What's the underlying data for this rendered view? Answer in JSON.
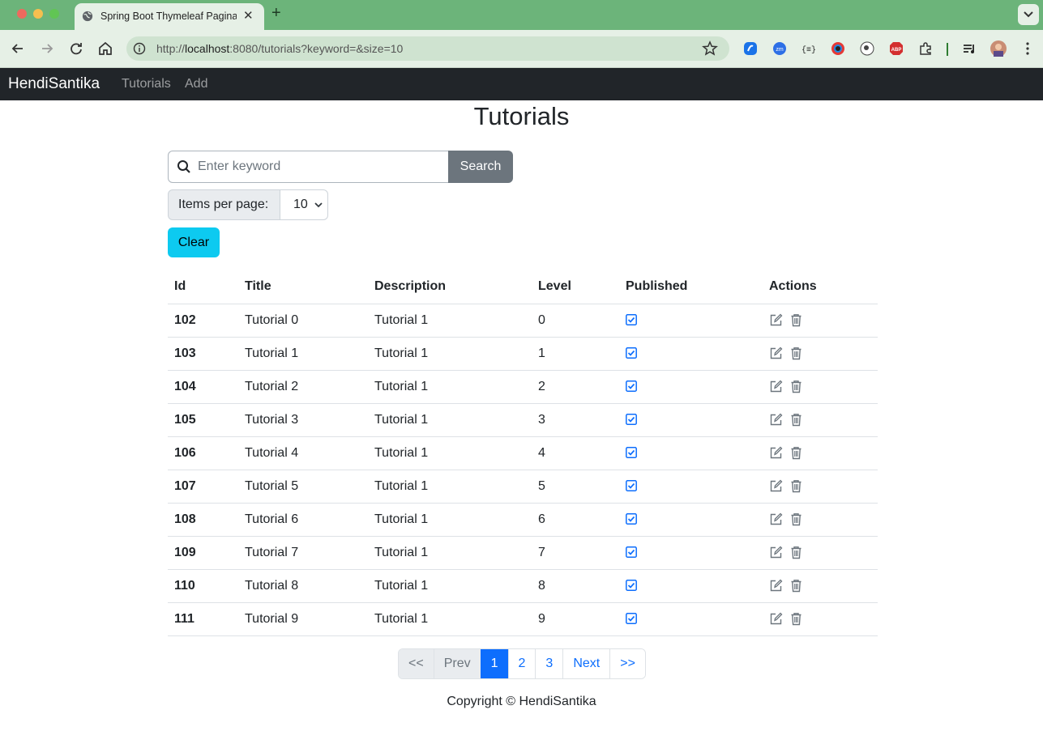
{
  "browser": {
    "tab_title": "Spring Boot Thymeleaf Paginatio",
    "url_prefix": "http://",
    "url_host": "localhost",
    "url_rest": ":8080/tutorials?keyword=&size=10"
  },
  "navbar": {
    "brand": "HendiSantika",
    "links": [
      "Tutorials",
      "Add"
    ]
  },
  "page": {
    "title": "Tutorials",
    "search_placeholder": "Enter keyword",
    "search_button": "Search",
    "items_per_page_label": "Items per page:",
    "items_per_page_value": "10",
    "clear_button": "Clear"
  },
  "table": {
    "headers": [
      "Id",
      "Title",
      "Description",
      "Level",
      "Published",
      "Actions"
    ],
    "rows": [
      {
        "id": "102",
        "title": "Tutorial 0",
        "description": "Tutorial 1",
        "level": "0",
        "published": true
      },
      {
        "id": "103",
        "title": "Tutorial 1",
        "description": "Tutorial 1",
        "level": "1",
        "published": true
      },
      {
        "id": "104",
        "title": "Tutorial 2",
        "description": "Tutorial 1",
        "level": "2",
        "published": true
      },
      {
        "id": "105",
        "title": "Tutorial 3",
        "description": "Tutorial 1",
        "level": "3",
        "published": true
      },
      {
        "id": "106",
        "title": "Tutorial 4",
        "description": "Tutorial 1",
        "level": "4",
        "published": true
      },
      {
        "id": "107",
        "title": "Tutorial 5",
        "description": "Tutorial 1",
        "level": "5",
        "published": true
      },
      {
        "id": "108",
        "title": "Tutorial 6",
        "description": "Tutorial 1",
        "level": "6",
        "published": true
      },
      {
        "id": "109",
        "title": "Tutorial 7",
        "description": "Tutorial 1",
        "level": "7",
        "published": true
      },
      {
        "id": "110",
        "title": "Tutorial 8",
        "description": "Tutorial 1",
        "level": "8",
        "published": true
      },
      {
        "id": "111",
        "title": "Tutorial 9",
        "description": "Tutorial 1",
        "level": "9",
        "published": true
      }
    ]
  },
  "pagination": {
    "first": "<<",
    "prev": "Prev",
    "pages": [
      "1",
      "2",
      "3"
    ],
    "active_page": "1",
    "next": "Next",
    "last": ">>"
  },
  "footer": "Copyright © HendiSantika",
  "colors": {
    "navbar_bg": "#212529",
    "primary": "#0d6efd",
    "info": "#0dcaf0",
    "secondary": "#6c757d",
    "browser_frame": "#6cb47a"
  }
}
